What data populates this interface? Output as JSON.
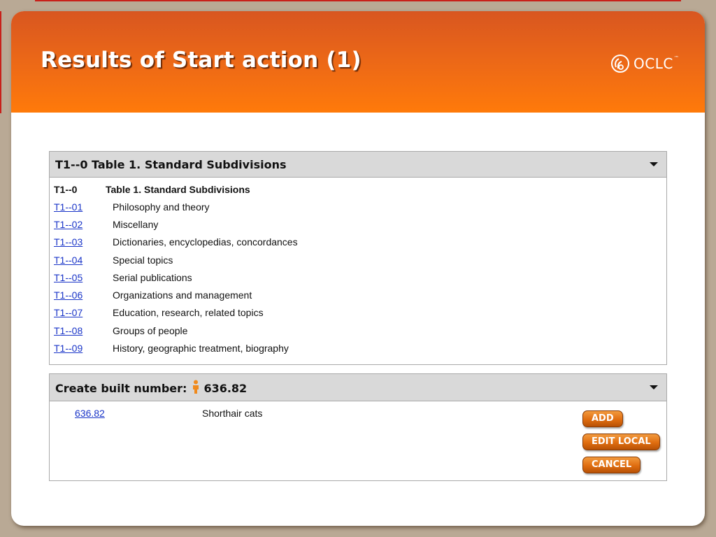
{
  "slide": {
    "title": "Results of Start action (1)"
  },
  "logo": {
    "icon": "oclc-logo-icon",
    "text": "OCLC",
    "trademark": "™"
  },
  "colors": {
    "header_gradient_top": "#d85620",
    "header_gradient_bottom": "#ff7a0a",
    "link": "#1a35c8",
    "panel_header_bg": "#d9d9d9",
    "button_orange": "#e06d10",
    "background": "#b9a995"
  },
  "table_panel": {
    "title": "T1--0 Table 1. Standard Subdivisions",
    "header_row": {
      "code": "T1--0",
      "desc": "Table 1. Standard Subdivisions"
    },
    "rows": [
      {
        "code": "T1--01",
        "desc": "Philosophy and theory"
      },
      {
        "code": "T1--02",
        "desc": "Miscellany"
      },
      {
        "code": "T1--03",
        "desc": "Dictionaries, encyclopedias, concordances"
      },
      {
        "code": "T1--04",
        "desc": "Special topics"
      },
      {
        "code": "T1--05",
        "desc": "Serial publications"
      },
      {
        "code": "T1--06",
        "desc": "Organizations and management"
      },
      {
        "code": "T1--07",
        "desc": "Education, research, related topics"
      },
      {
        "code": "T1--08",
        "desc": "Groups of people"
      },
      {
        "code": "T1--09",
        "desc": "History, geographic treatment, biography"
      }
    ]
  },
  "built_panel": {
    "label": "Create built number:",
    "icon": "person-icon",
    "number": "636.82",
    "result": {
      "code": "636.82",
      "desc": "Shorthair cats"
    },
    "buttons": {
      "add": "ADD",
      "edit_local": "EDIT LOCAL",
      "cancel": "CANCEL"
    }
  }
}
